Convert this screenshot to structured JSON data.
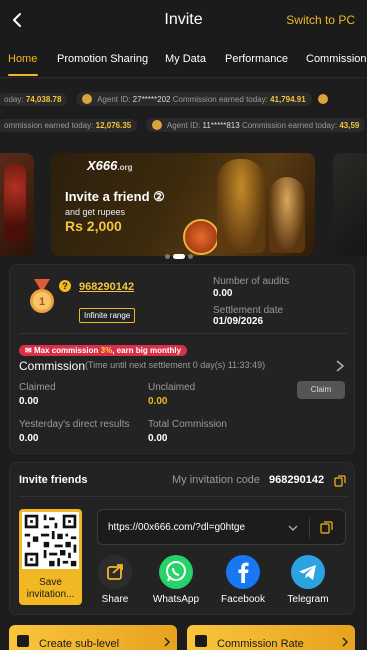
{
  "header": {
    "title": "Invite",
    "switch_label": "Switch to PC"
  },
  "tabs": [
    {
      "label": "Home"
    },
    {
      "label": "Promotion Sharing"
    },
    {
      "label": "My Data"
    },
    {
      "label": "Performance"
    },
    {
      "label": "Commission"
    }
  ],
  "ticker1": {
    "prefix": "oday:",
    "value1": "74,038.78",
    "agent_label": "Agent ID:",
    "agent_id": "27*****202",
    "earned_label": "Commission earned today:",
    "value2": "41,794.91"
  },
  "ticker2": {
    "earned_label": "ommission earned today:",
    "value1": "12,076.35",
    "agent_label": "Agent ID:",
    "agent_id": "11*****813",
    "earned_label2": "Commission earned today:",
    "value2": "43,59"
  },
  "banner": {
    "logo": "X666",
    "logo_suffix": ".org",
    "line1": "Invite a friend ②",
    "line2": "and get rupees",
    "line3": "Rs 2,000"
  },
  "commission_card": {
    "user_id": "968290142",
    "range_label": "Infinite range",
    "audits_label": "Number of audits",
    "audits_value": "0.00",
    "settlement_label": "Settlement date",
    "settlement_value": "01/09/2026",
    "promo_prefix": "Max commission ",
    "promo_highlight": "3%",
    "promo_suffix": ", earn big monthly",
    "title": "Commission",
    "subtitle": "(Time until next settlement  0 day(s) 11:33:49)",
    "claimed_label": "Claimed",
    "claimed_value": "0.00",
    "unclaimed_label": "Unclaimed",
    "unclaimed_value": "0.00",
    "claim_button": "Claim",
    "yesterday_label": "Yesterday's direct results",
    "yesterday_value": "0.00",
    "total_label": "Total Commission",
    "total_value": "0.00"
  },
  "invite_card": {
    "title": "Invite friends",
    "code_label": "My invitation code",
    "code_value": "968290142",
    "save_label": "Save invitation...",
    "url": "https://00x666.com/?dl=g0htge",
    "share": [
      {
        "label": "Share",
        "color": "#2c2c2c"
      },
      {
        "label": "WhatsApp",
        "color": "#25d366"
      },
      {
        "label": "Facebook",
        "color": "#1877f2"
      },
      {
        "label": "Telegram",
        "color": "#2aa3e0"
      }
    ]
  },
  "bottom_buttons": {
    "create_sublevel": "Create sub-level",
    "commission_rate": "Commission Rate"
  },
  "colors": {
    "accent": "#f2b824",
    "background": "#1d1d1d",
    "card": "#232323"
  }
}
